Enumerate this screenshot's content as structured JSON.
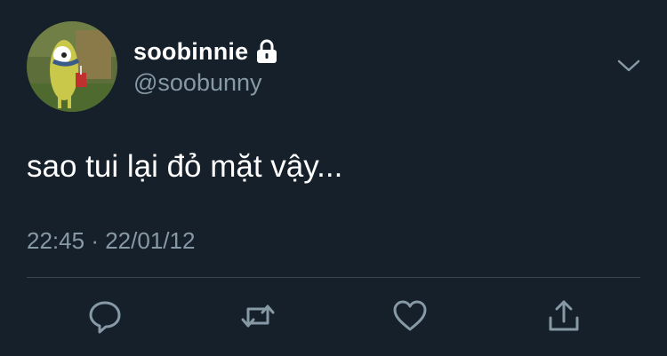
{
  "tweet": {
    "display_name": "soobinnie",
    "handle": "@soobunny",
    "text": "sao tui lại đỏ mặt vậy...",
    "time": "22:45",
    "separator": "·",
    "date": "22/01/12"
  },
  "icons": {
    "lock": "lock-icon",
    "more": "chevron-down-icon",
    "reply": "reply-icon",
    "retweet": "retweet-icon",
    "like": "heart-icon",
    "share": "share-icon"
  },
  "colors": {
    "background": "#15202b",
    "text_primary": "#ffffff",
    "text_secondary": "#8899a6",
    "divider": "#38444d"
  }
}
